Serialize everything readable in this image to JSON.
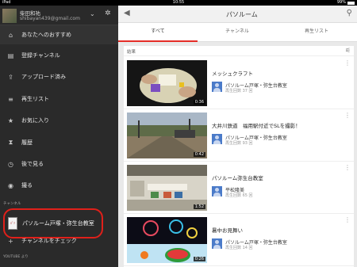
{
  "status": {
    "carrier": "iPad",
    "time": "10:55",
    "battery": "99%"
  },
  "account": {
    "name": "柴田和祐",
    "email": "shibayan439@gmail.com"
  },
  "nav": [
    {
      "icon": "⌂",
      "icon_name": "home-icon",
      "label": "あなたへのおすすめ"
    },
    {
      "icon": "▤",
      "icon_name": "subscriptions-icon",
      "label": "登録チャンネル"
    },
    {
      "icon": "⇪",
      "icon_name": "upload-icon",
      "label": "アップロード済み"
    },
    {
      "icon": "≡",
      "icon_name": "playlist-icon",
      "label": "再生リスト"
    },
    {
      "icon": "★",
      "icon_name": "star-icon",
      "label": "お気に入り"
    },
    {
      "icon": "⧗",
      "icon_name": "history-icon",
      "label": "履歴"
    },
    {
      "icon": "◷",
      "icon_name": "clock-icon",
      "label": "後で見る"
    },
    {
      "icon": "◉",
      "icon_name": "record-icon",
      "label": "撮る"
    }
  ],
  "sections": {
    "channels": "チャンネル",
    "from_youtube": "YOUTUBE より"
  },
  "channel": {
    "label": "パソルーム戸塚・弥生台教室",
    "thumb_text": "ﾊﾟｿ"
  },
  "check_channels": {
    "icon": "+",
    "label": "チャンネルをチェック"
  },
  "appbar": {
    "title": "パソルーム"
  },
  "tabs": [
    "すべて",
    "チャンネル",
    "再生リスト"
  ],
  "feed_label": "結果",
  "videos": [
    {
      "title": "メッシュクラフト",
      "channel": "パソルーム戸塚・弥生台教室",
      "views": "再生回数 37 回",
      "duration": "0:36"
    },
    {
      "title": "大井川鉄道　福用駅付近でSLを撮影！",
      "channel": "パソルーム戸塚・弥生台教室",
      "views": "再生回数 93 回",
      "duration": "0:42"
    },
    {
      "title": "パソルーム弥生台教室",
      "channel": "平松隆美",
      "views": "再生回数 65 回",
      "duration": "1:52"
    },
    {
      "title": "暑中お見舞い",
      "channel": "パソルーム戸塚・弥生台教室",
      "views": "再生回数 14 回",
      "duration": "0:26"
    }
  ],
  "colors": {
    "accent": "#e52d27",
    "highlight_ring": "#e0201a",
    "sidebar_bg": "#2a2a2a"
  }
}
